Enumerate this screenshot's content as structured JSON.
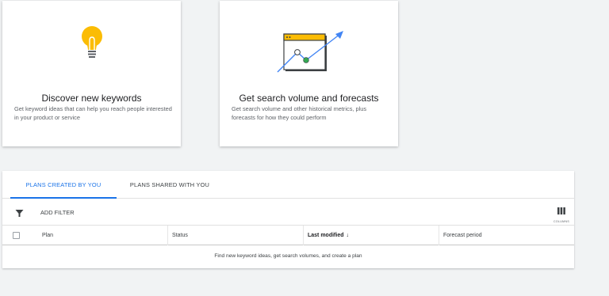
{
  "cards": [
    {
      "title": "Discover new keywords",
      "description": "Get keyword ideas that can help you reach people interested in your product or service",
      "icon": "lightbulb-icon"
    },
    {
      "title": "Get search volume and forecasts",
      "description": "Get search volume and other historical metrics, plus forecasts for how they could perform",
      "icon": "trend-chart-icon"
    }
  ],
  "tabs": [
    {
      "label": "PLANS CREATED BY YOU",
      "active": true
    },
    {
      "label": "PLANS SHARED WITH YOU",
      "active": false
    }
  ],
  "toolbar": {
    "filter_icon": "filter-icon",
    "add_filter_label": "ADD FILTER",
    "columns_label": "COLUMNS",
    "columns_icon": "columns-icon"
  },
  "table": {
    "columns": [
      "Plan",
      "Status",
      "Last modified",
      "Forecast period"
    ],
    "sort_column": "Last modified",
    "sort_icon": "arrow-down-icon",
    "empty_message": "Find new keyword ideas, get search volumes, and create a plan"
  },
  "colors": {
    "accent": "#1a73e8",
    "bulb": "#fbbc04",
    "trend_arrow": "#4285f4",
    "trend_point": "#34a853"
  }
}
